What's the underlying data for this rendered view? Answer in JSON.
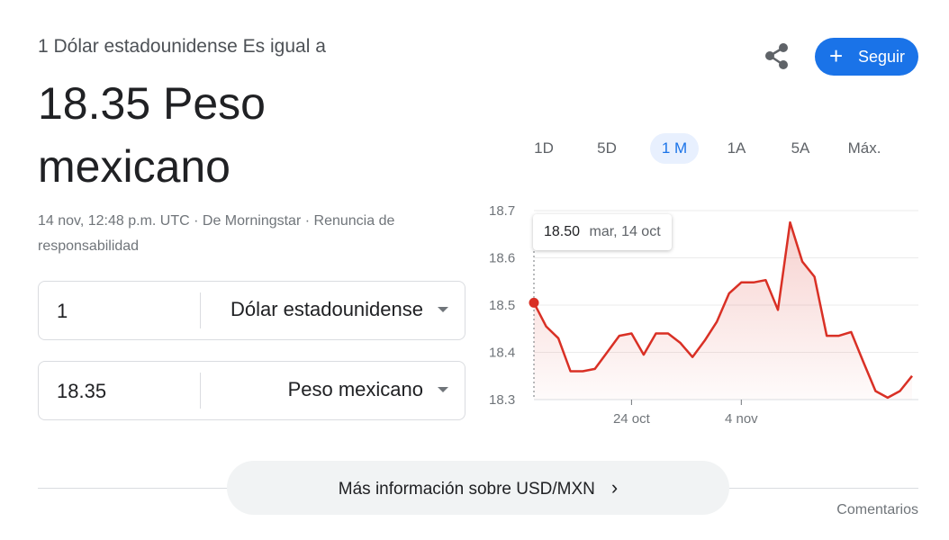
{
  "header": {
    "subtitle": "1 Dólar estadounidense Es igual a",
    "rate_line1": "18.35 Peso",
    "rate_line2": "mexicano"
  },
  "meta": {
    "timestamp": "14 nov, 12:48 p.m. UTC",
    "source": "De Morningstar",
    "disclaimer": "Renuncia de responsabilidad",
    "separator": "·"
  },
  "converter": {
    "from_amount": "1",
    "from_currency": "Dólar estadounidense",
    "to_amount": "18.35",
    "to_currency": "Peso mexicano"
  },
  "actions": {
    "follow_label": "Seguir",
    "follow_icon": "plus-icon",
    "share_icon": "share-icon"
  },
  "tabs": [
    {
      "label": "1D",
      "active": false
    },
    {
      "label": "5D",
      "active": false
    },
    {
      "label": "1 M",
      "active": true
    },
    {
      "label": "1A",
      "active": false
    },
    {
      "label": "5A",
      "active": false
    },
    {
      "label": "Máx.",
      "active": false
    }
  ],
  "tooltip": {
    "value": "18.50",
    "date": "mar, 14 oct"
  },
  "chart_data": {
    "type": "area",
    "y_ticks": [
      "18.7",
      "18.6",
      "18.5",
      "18.4",
      "18.3"
    ],
    "ylim": [
      18.3,
      18.7
    ],
    "x_ticks": [
      {
        "label": "24 oct",
        "index": 8
      },
      {
        "label": "4 nov",
        "index": 17
      }
    ],
    "values": [
      18.505,
      18.455,
      18.43,
      18.36,
      18.36,
      18.365,
      18.4,
      18.435,
      18.44,
      18.395,
      18.44,
      18.44,
      18.42,
      18.39,
      18.425,
      18.465,
      18.525,
      18.548,
      18.548,
      18.553,
      18.49,
      18.675,
      18.592,
      18.56,
      18.435,
      18.435,
      18.443,
      18.38,
      18.318,
      18.304,
      18.318,
      18.35
    ],
    "line_color": "#d93025",
    "grid": true
  },
  "footer": {
    "more_label": "Más información sobre USD/MXN",
    "feedback": "Comentarios"
  }
}
